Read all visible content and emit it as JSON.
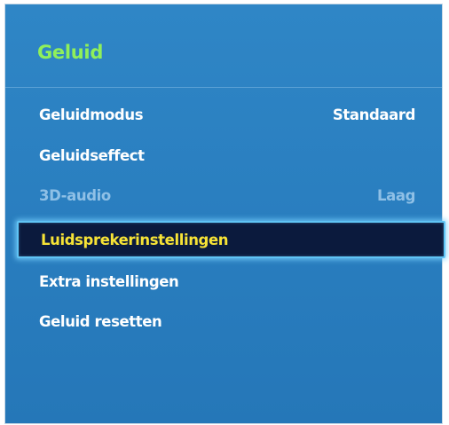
{
  "menu": {
    "title": "Geluid",
    "title_color": "#8ff05a",
    "selected_color": "#f7e336",
    "items": [
      {
        "label": "Geluidmodus",
        "value": "Standaard",
        "state": "normal"
      },
      {
        "label": "Geluidseffect",
        "value": "",
        "state": "normal"
      },
      {
        "label": "3D-audio",
        "value": "Laag",
        "state": "disabled"
      },
      {
        "label": "Luidsprekerinstellingen",
        "value": "",
        "state": "selected"
      },
      {
        "label": "Extra instellingen",
        "value": "",
        "state": "normal"
      },
      {
        "label": "Geluid resetten",
        "value": "",
        "state": "normal"
      }
    ]
  }
}
